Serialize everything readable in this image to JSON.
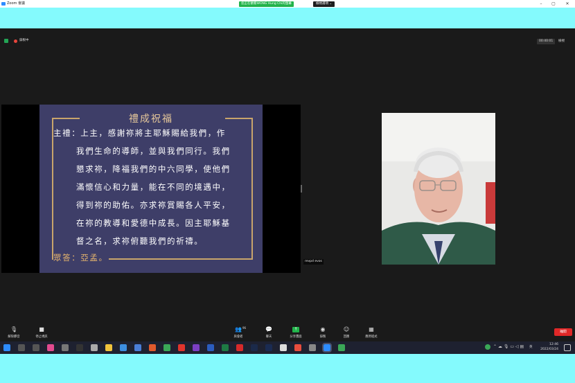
{
  "window": {
    "title": "Zoom 會議",
    "viewing_banner": "您正在觀看WONG Hung Chi的螢幕",
    "view_options": "檢視選項 ⌄"
  },
  "top": {
    "recording": "錄製中",
    "timer": "00:40:01",
    "view": "檢視"
  },
  "slide": {
    "title": "禮成祝福",
    "lines": [
      "主禮：上主，感謝祢將主耶穌賜給我們，作",
      "我們生命的導師，並與我們同行。我們",
      "懇求祢，降福我們的中六同學，使他們",
      "滿懷信心和力量，能在不同的境遇中，",
      "得到祢的助佑。亦求祢賞賜各人平安，",
      "在祢的教導和愛德中成長。因主耶穌基",
      "督之名，求祢俯聽我們的祈禱。"
    ],
    "response": "眾答：亞孟。"
  },
  "video": {
    "name": "revpd evos"
  },
  "toolbar": {
    "mute": "解除靜音",
    "video": "停止視訊",
    "participants": "與會者",
    "participants_count": "96",
    "chat": "聊天",
    "share": "分享畫面",
    "record": "錄製",
    "reactions": "回應",
    "apps": "應用程式",
    "leave": "離開"
  },
  "taskbar": {
    "time": "12:46",
    "date": "2022/03/24",
    "lang": "英"
  },
  "colors": {
    "page_bg": "#84fafd",
    "zoom_bg": "#1a1a1a",
    "slide_bg": "#3e3e68",
    "slide_gold": "#e5c79a",
    "green": "#21b34a",
    "leave_red": "#e02828"
  }
}
